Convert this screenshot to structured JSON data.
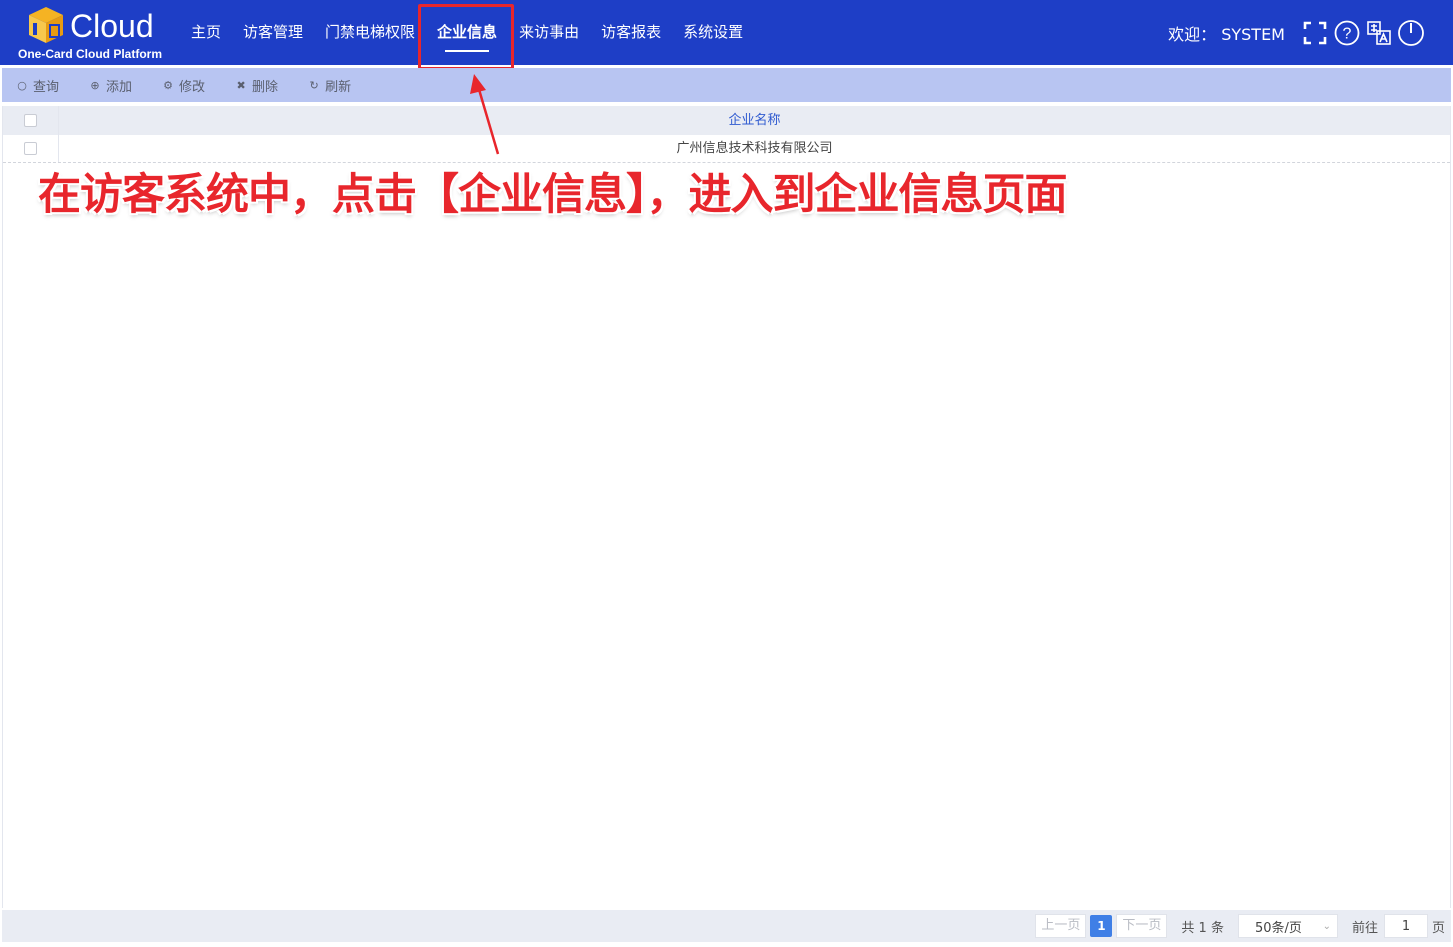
{
  "header": {
    "logo_word": "Cloud",
    "logo_sub": "One-Card Cloud Platform",
    "nav": [
      {
        "label": "主页",
        "active": false
      },
      {
        "label": "访客管理",
        "active": false
      },
      {
        "label": "门禁电梯权限",
        "active": false
      },
      {
        "label": "企业信息",
        "active": true
      },
      {
        "label": "来访事由",
        "active": false
      },
      {
        "label": "访客报表",
        "active": false
      },
      {
        "label": "系统设置",
        "active": false
      }
    ],
    "welcome": "欢迎： SYSTEM",
    "icons": [
      "fullscreen-icon",
      "help-icon",
      "language-icon",
      "power-icon"
    ]
  },
  "toolbar": {
    "buttons": [
      {
        "label": "查询",
        "icon": "search-icon"
      },
      {
        "label": "添加",
        "icon": "add-icon"
      },
      {
        "label": "修改",
        "icon": "gear-icon"
      },
      {
        "label": "删除",
        "icon": "delete-icon"
      },
      {
        "label": "刷新",
        "icon": "refresh-icon"
      }
    ]
  },
  "table": {
    "columns": [
      "企业名称"
    ],
    "rows": [
      [
        "广州信息技术科技有限公司"
      ]
    ]
  },
  "annotation": "在访客系统中，点击【企业信息】，进入到企业信息页面",
  "pager": {
    "prev": "上一页",
    "current": "1",
    "next": "下一页",
    "total": "共 1 条",
    "page_size": "50条/页",
    "goto_label": "前往",
    "goto_value": "1",
    "page_suffix": "页"
  },
  "colors": {
    "header_bg": "#1e3ec6",
    "toolbar_bg": "#b8c5f2",
    "highlight": "#e8262c",
    "accent": "#3f7fe6"
  }
}
